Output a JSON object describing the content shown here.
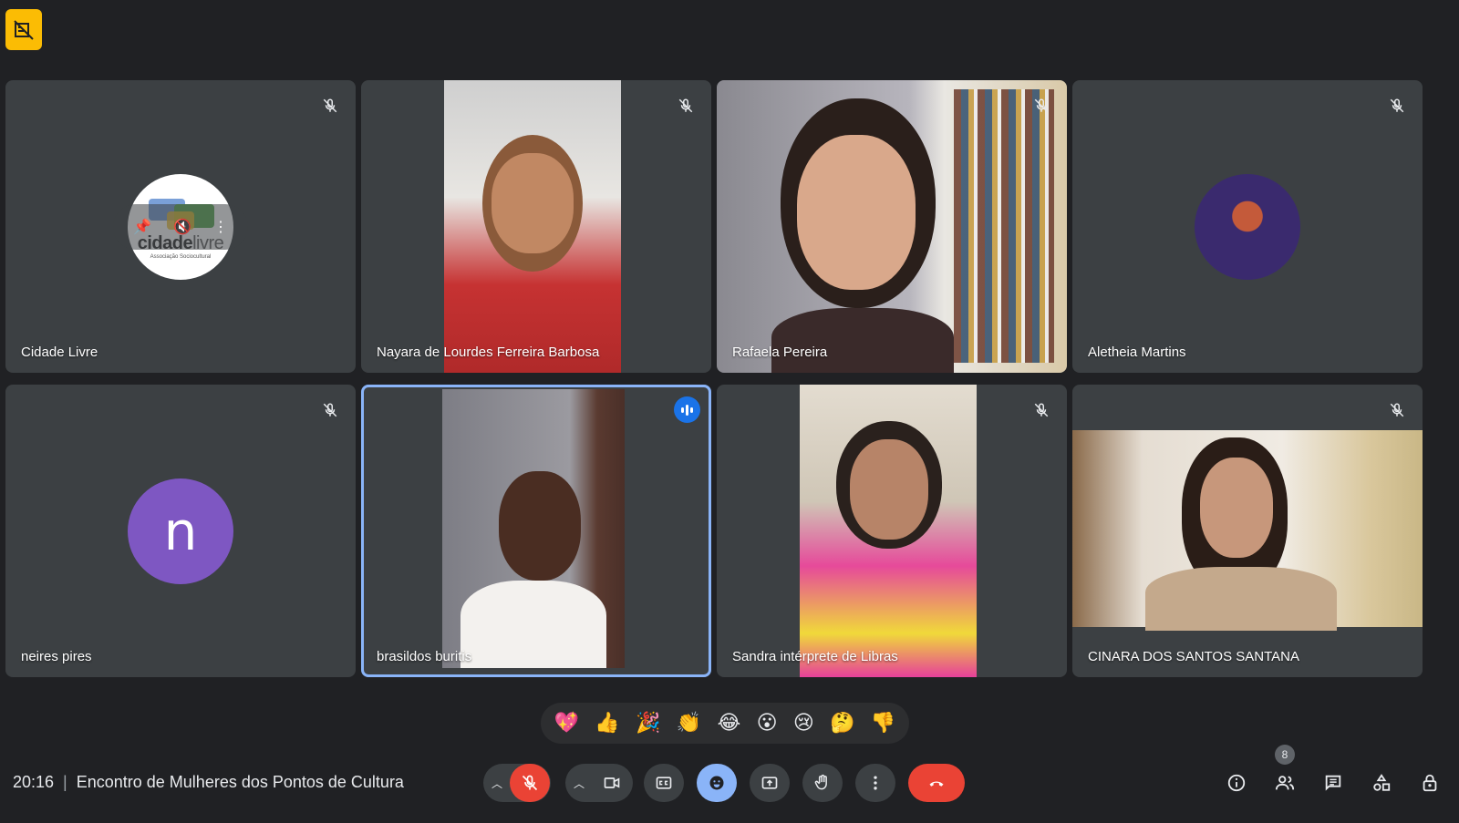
{
  "meeting": {
    "time": "20:16",
    "separator": "|",
    "title": "Encontro de Mulheres dos Pontos de Cultura",
    "participant_count": "8"
  },
  "participants": [
    {
      "name": "Cidade Livre",
      "muted": true,
      "kind": "logo-avatar",
      "logo_text_a": "cidade",
      "logo_text_b": "livre",
      "logo_sub": "Associação Sociocultural"
    },
    {
      "name": "Nayara de Lourdes Ferreira Barbosa",
      "muted": true,
      "kind": "video"
    },
    {
      "name": "Rafaela Pereira",
      "muted": true,
      "kind": "video"
    },
    {
      "name": "Aletheia Martins",
      "muted": true,
      "kind": "photo-avatar"
    },
    {
      "name": "neires pires",
      "muted": true,
      "kind": "letter-avatar",
      "initial": "n"
    },
    {
      "name": "brasildos buritis",
      "muted": false,
      "speaking": true,
      "kind": "video"
    },
    {
      "name": "Sandra intérprete de Libras",
      "muted": true,
      "kind": "video"
    },
    {
      "name": "CINARA DOS SANTOS SANTANA",
      "muted": true,
      "kind": "video"
    }
  ],
  "reactions": [
    "💖",
    "👍",
    "🎉",
    "👏",
    "😂",
    "😮",
    "😢",
    "🤔",
    "👎"
  ],
  "colors": {
    "background": "#202124",
    "tile": "#3c4043",
    "active_outline": "#8ab4f8",
    "end_call": "#ea4335",
    "accent_blue": "#8ab4f8",
    "badge_yellow": "#fbbc04",
    "avatar_purple": "#7e57c2"
  },
  "icons": {
    "topbar": "no-recording-icon",
    "mic_off": "mic-off-icon",
    "camera": "videocam-icon",
    "captions": "closed-captions-icon",
    "emoji": "emoji-icon",
    "present": "present-screen-icon",
    "hand": "raise-hand-icon",
    "more": "more-vert-icon",
    "end": "call-end-icon",
    "info": "info-icon",
    "people": "people-icon",
    "chat": "chat-icon",
    "activities": "activities-icon",
    "host": "host-controls-icon"
  }
}
